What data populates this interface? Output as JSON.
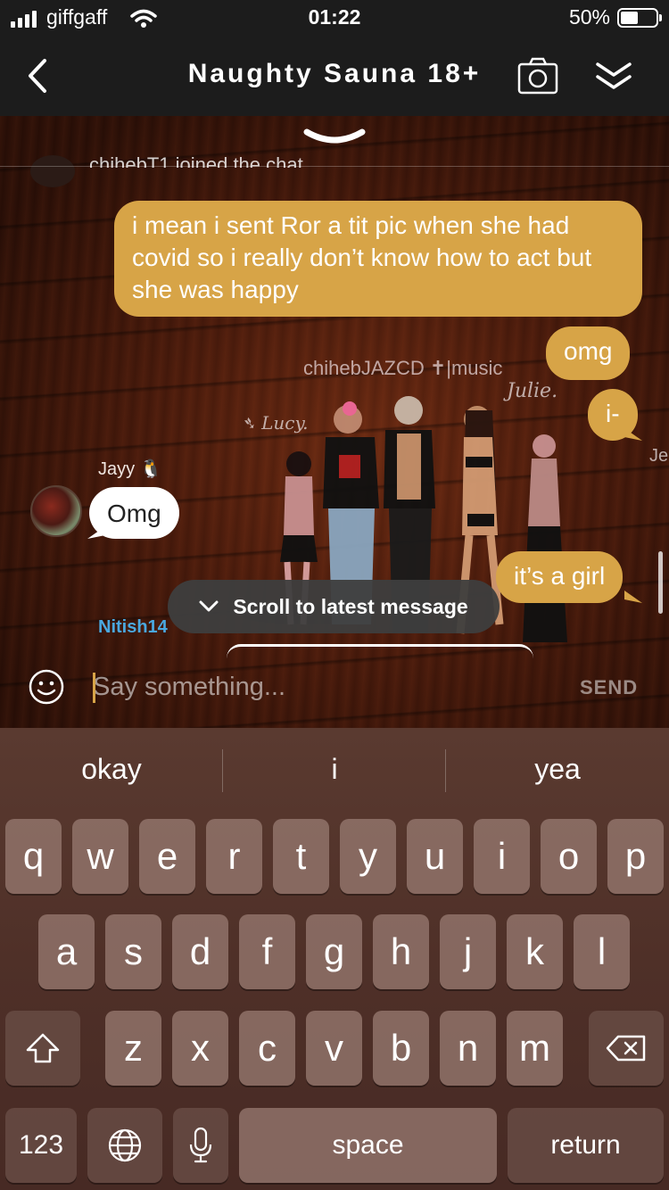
{
  "status_bar": {
    "carrier": "giffgaff",
    "time": "01:22",
    "battery": "50%"
  },
  "header": {
    "title": "Naughty Sauna 18+"
  },
  "chat": {
    "system_cut": "chihebT1 joined the chat",
    "messages": [
      {
        "text": "i mean i sent Ror a tit pic when she had covid so i really don’t know how to act but she was happy"
      },
      {
        "text": "omg"
      },
      {
        "text": "i-"
      },
      {
        "sender": "Jayy",
        "text": "Omg"
      },
      {
        "text": "it’s a girl"
      }
    ],
    "scene_labels": {
      "chiheb": "chihebJAZCD ✝|music",
      "julie": "Julie.",
      "lucy": "➴ Lucy.",
      "je": "Je"
    },
    "scroll_to_latest": "Scroll to latest message",
    "next_sender": "Nitish14"
  },
  "input": {
    "placeholder": "Say something...",
    "send_label": "SEND"
  },
  "keyboard": {
    "suggestions": [
      "okay",
      "i",
      "yea"
    ],
    "row1": [
      "q",
      "w",
      "e",
      "r",
      "t",
      "y",
      "u",
      "i",
      "o",
      "p"
    ],
    "row2": [
      "a",
      "s",
      "d",
      "f",
      "g",
      "h",
      "j",
      "k",
      "l"
    ],
    "row3": [
      "z",
      "x",
      "c",
      "v",
      "b",
      "n",
      "m"
    ],
    "numbers_label": "123",
    "space_label": "space",
    "return_label": "return"
  }
}
